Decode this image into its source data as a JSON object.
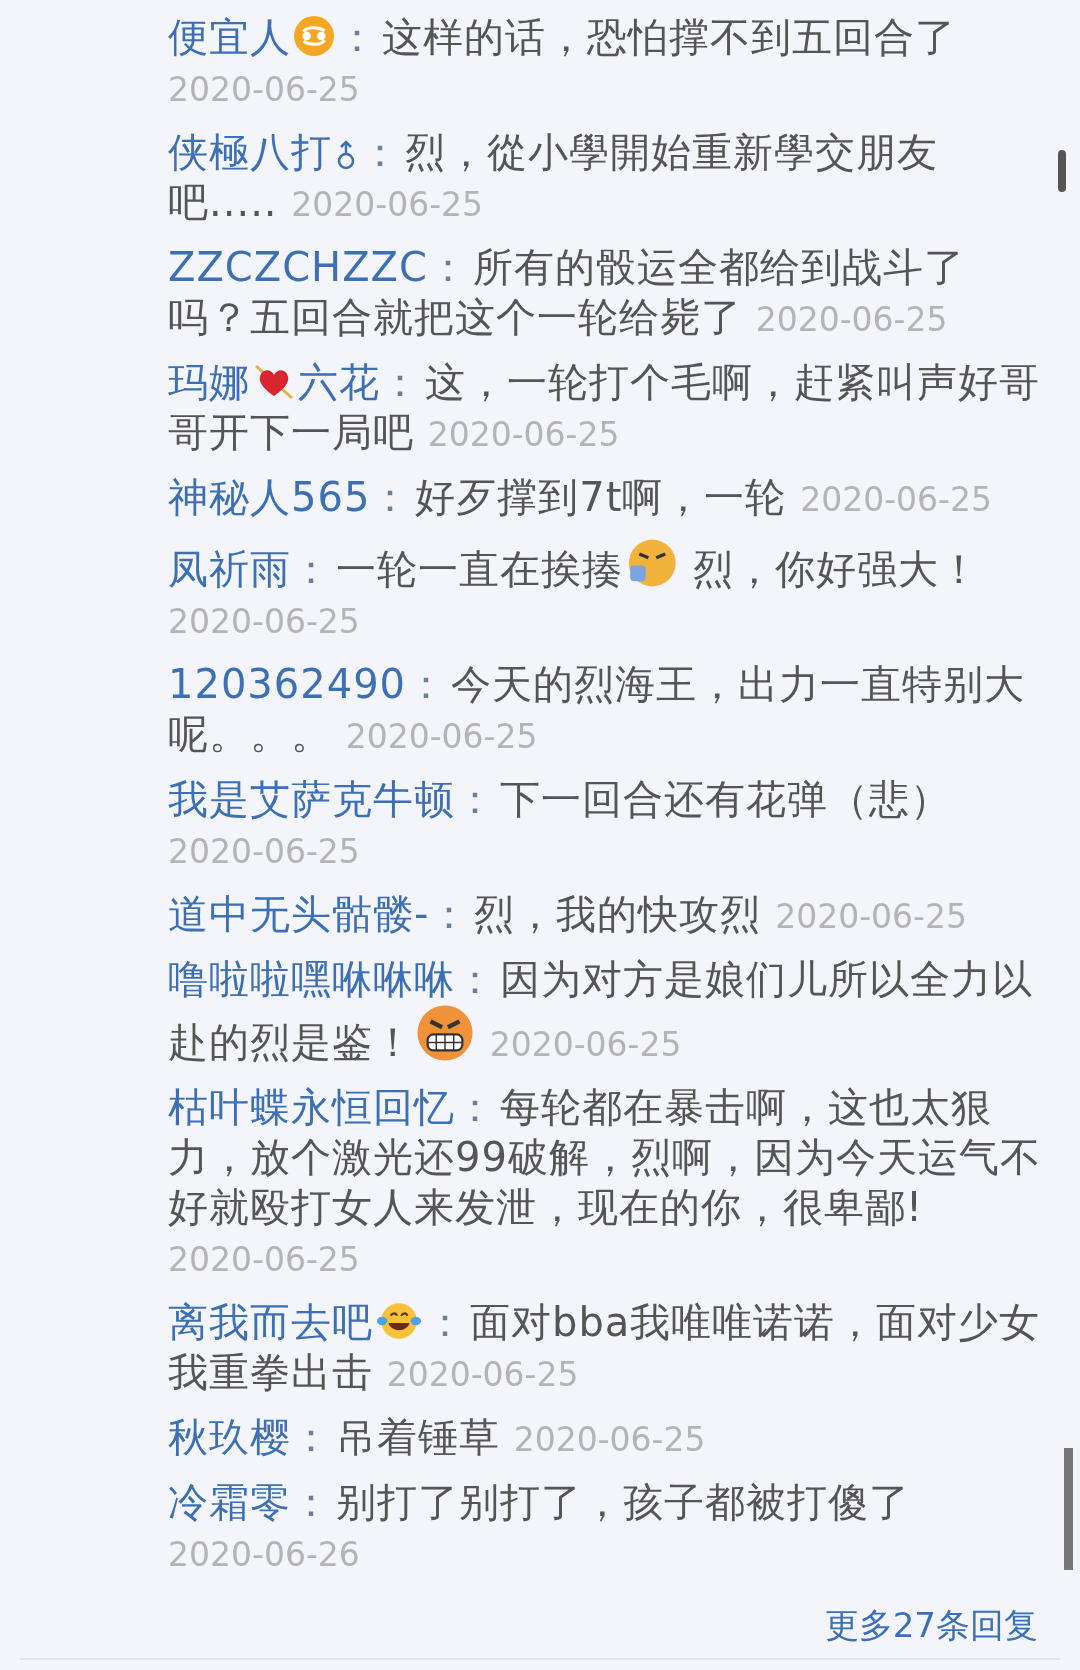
{
  "replies": [
    {
      "name": [
        {
          "kind": "text",
          "text": "便宜人"
        },
        {
          "kind": "zodiac"
        }
      ],
      "separator": "：",
      "body": [
        {
          "kind": "text",
          "text": "这样的话，恐怕撑不到五回合了"
        }
      ],
      "date": "2020-06-25"
    },
    {
      "name": [
        {
          "kind": "text",
          "text": "侠極八打"
        },
        {
          "kind": "male"
        }
      ],
      "separator": "：",
      "body": [
        {
          "kind": "text",
          "text": "烈，從小學開始重新學交朋友吧....."
        }
      ],
      "date": "2020-06-25"
    },
    {
      "name": [
        {
          "kind": "text",
          "text": "ZZCZCHZZC"
        }
      ],
      "separator": "：",
      "body": [
        {
          "kind": "text",
          "text": "所有的骰运全都给到战斗了吗？五回合就把这个一轮给毙了"
        }
      ],
      "date": "2020-06-25"
    },
    {
      "name": [
        {
          "kind": "text",
          "text": "玛娜"
        },
        {
          "kind": "heart"
        },
        {
          "kind": "text",
          "text": "六花"
        }
      ],
      "separator": "：",
      "body": [
        {
          "kind": "text",
          "text": "这，一轮打个毛啊，赶紧叫声好哥哥开下一局吧"
        }
      ],
      "date": "2020-06-25"
    },
    {
      "name": [
        {
          "kind": "text",
          "text": "神秘人565"
        }
      ],
      "separator": "：",
      "body": [
        {
          "kind": "text",
          "text": "好歹撑到7t啊，一轮"
        }
      ],
      "date": "2020-06-25"
    },
    {
      "name": [
        {
          "kind": "text",
          "text": "凤祈雨"
        }
      ],
      "separator": "：",
      "body": [
        {
          "kind": "text",
          "text": "一轮一直在挨揍"
        },
        {
          "kind": "angry"
        },
        {
          "kind": "text",
          "text": " 烈，你好强大！"
        }
      ],
      "date": "2020-06-25"
    },
    {
      "name": [
        {
          "kind": "text",
          "text": "120362490"
        }
      ],
      "separator": "：",
      "body": [
        {
          "kind": "text",
          "text": "今天的烈海王，出力一直特别大呢。。。"
        }
      ],
      "date": "2020-06-25"
    },
    {
      "name": [
        {
          "kind": "text",
          "text": "我是艾萨克牛顿"
        }
      ],
      "separator": "：",
      "body": [
        {
          "kind": "text",
          "text": "下一回合还有花弹（悲）"
        }
      ],
      "date": "2020-06-25"
    },
    {
      "name": [
        {
          "kind": "text",
          "text": "道中无头骷髅-"
        }
      ],
      "separator": "：",
      "body": [
        {
          "kind": "text",
          "text": "烈，我的快攻烈"
        }
      ],
      "date": "2020-06-25"
    },
    {
      "name": [
        {
          "kind": "text",
          "text": "噜啦啦嘿咻咻咻"
        }
      ],
      "separator": "：",
      "body": [
        {
          "kind": "text",
          "text": "因为对方是娘们儿所以全力以赴的烈是鉴！"
        },
        {
          "kind": "grimace"
        }
      ],
      "date": "2020-06-25"
    },
    {
      "name": [
        {
          "kind": "text",
          "text": "枯叶蝶永恒回忆"
        }
      ],
      "separator": "：",
      "body": [
        {
          "kind": "text",
          "text": "每轮都在暴击啊，这也太狠力，放个激光还99破解，烈啊，因为今天运气不好就殴打女人来发泄，现在的你，很卑鄙!"
        }
      ],
      "date": "2020-06-25"
    },
    {
      "name": [
        {
          "kind": "text",
          "text": "离我而去吧"
        },
        {
          "kind": "laugh"
        }
      ],
      "separator": "：",
      "body": [
        {
          "kind": "text",
          "text": "面对bba我唯唯诺诺，面对少女我重拳出击"
        }
      ],
      "date": "2020-06-25"
    },
    {
      "name": [
        {
          "kind": "text",
          "text": "秋玖樱"
        }
      ],
      "separator": "：",
      "body": [
        {
          "kind": "text",
          "text": "吊着锤草"
        }
      ],
      "date": "2020-06-25"
    },
    {
      "name": [
        {
          "kind": "text",
          "text": "冷霜零"
        }
      ],
      "separator": "：",
      "body": [
        {
          "kind": "text",
          "text": "别打了别打了，孩子都被打傻了"
        }
      ],
      "date": "2020-06-26"
    }
  ],
  "more_link": "更多27条回复"
}
